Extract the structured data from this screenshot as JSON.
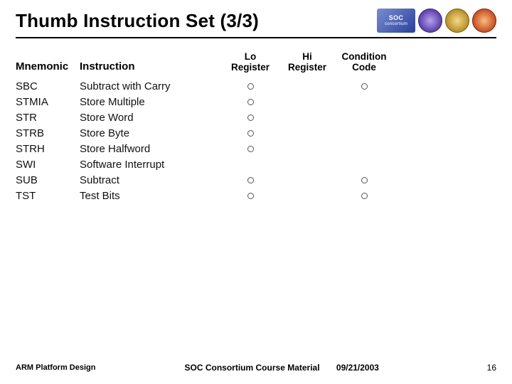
{
  "title": "Thumb Instruction Set (3/3)",
  "logos": {
    "consortium": "SOC",
    "consortium_sub": "consortium"
  },
  "columns": {
    "mnemonic": "Mnemonic",
    "instruction": "Instruction",
    "lo1": "Lo",
    "lo2": "Register",
    "hi1": "Hi",
    "hi2": "Register",
    "cond1": "Condition",
    "cond2": "Code"
  },
  "rows": [
    {
      "m": "SBC",
      "i": "Subtract with Carry",
      "lo": true,
      "hi": false,
      "cc": true
    },
    {
      "m": "STMIA",
      "i": "Store Multiple",
      "lo": true,
      "hi": false,
      "cc": false
    },
    {
      "m": "STR",
      "i": "Store Word",
      "lo": true,
      "hi": false,
      "cc": false
    },
    {
      "m": "STRB",
      "i": "Store Byte",
      "lo": true,
      "hi": false,
      "cc": false
    },
    {
      "m": "STRH",
      "i": "Store Halfword",
      "lo": true,
      "hi": false,
      "cc": false
    },
    {
      "m": "SWI",
      "i": "Software Interrupt",
      "lo": false,
      "hi": false,
      "cc": false
    },
    {
      "m": "SUB",
      "i": "Subtract",
      "lo": true,
      "hi": false,
      "cc": true
    },
    {
      "m": "TST",
      "i": "Test Bits",
      "lo": true,
      "hi": false,
      "cc": true
    }
  ],
  "footer": {
    "left": "ARM Platform Design",
    "mid": "SOC Consortium Course Material",
    "date": "09/21/2003",
    "page": "16"
  },
  "chart_data": {
    "type": "table",
    "title": "Thumb Instruction Set (3/3)",
    "columns": [
      "Mnemonic",
      "Instruction",
      "Lo Register",
      "Hi Register",
      "Condition Code"
    ],
    "rows": [
      [
        "SBC",
        "Subtract with Carry",
        true,
        false,
        true
      ],
      [
        "STMIA",
        "Store Multiple",
        true,
        false,
        false
      ],
      [
        "STR",
        "Store Word",
        true,
        false,
        false
      ],
      [
        "STRB",
        "Store Byte",
        true,
        false,
        false
      ],
      [
        "STRH",
        "Store Halfword",
        true,
        false,
        false
      ],
      [
        "SWI",
        "Software Interrupt",
        false,
        false,
        false
      ],
      [
        "SUB",
        "Subtract",
        true,
        false,
        true
      ],
      [
        "TST",
        "Test Bits",
        true,
        false,
        true
      ]
    ]
  }
}
